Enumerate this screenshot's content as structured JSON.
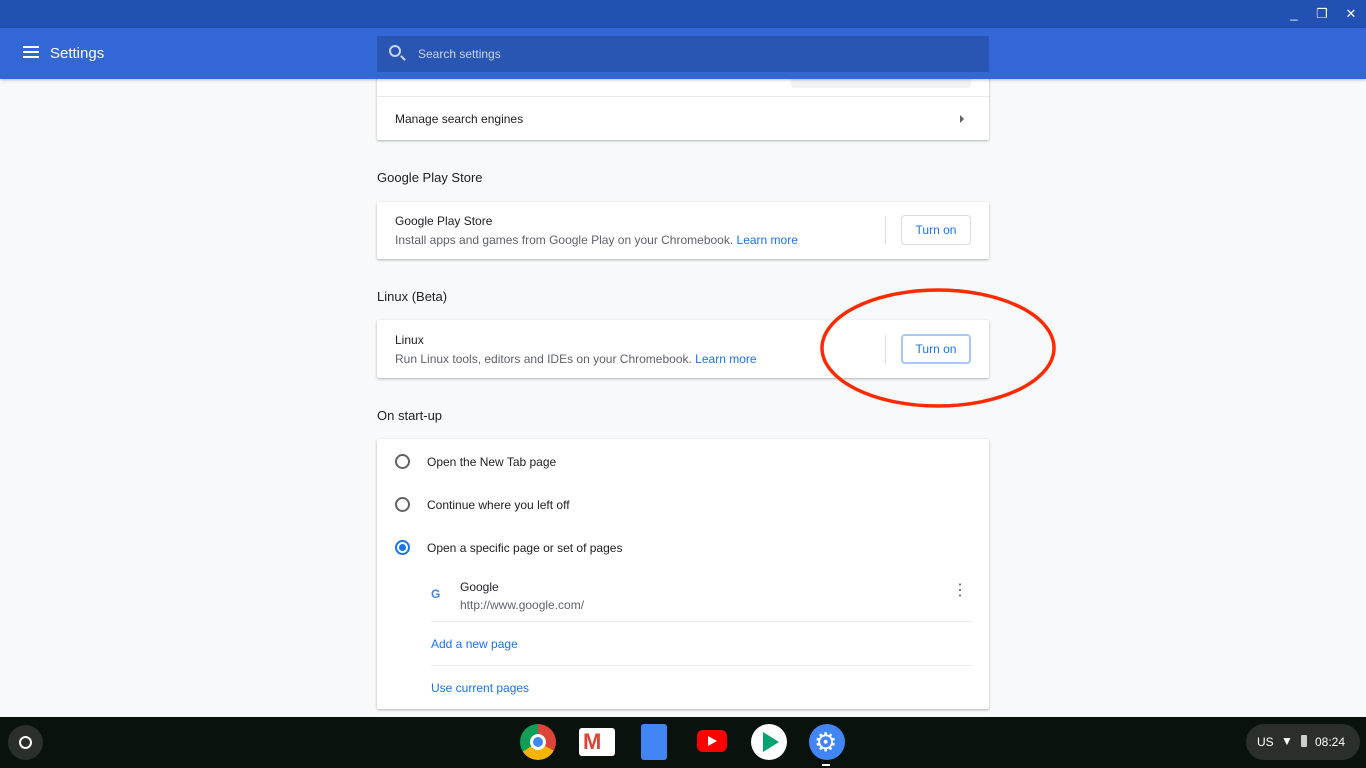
{
  "window": {
    "controls": [
      "minimize",
      "restore",
      "close"
    ]
  },
  "header": {
    "title": "Settings",
    "search_placeholder": "Search settings"
  },
  "search_engine": {
    "manage_label": "Manage search engines"
  },
  "play_store": {
    "section": "Google Play Store",
    "title": "Google Play Store",
    "desc": "Install apps and games from Google Play on your Chromebook.",
    "learn_more": "Learn more",
    "button": "Turn on"
  },
  "linux": {
    "section": "Linux (Beta)",
    "title": "Linux",
    "desc": "Run Linux tools, editors and IDEs on your Chromebook.",
    "learn_more": "Learn more",
    "button": "Turn on",
    "annotation_color": "#ff2a00"
  },
  "startup": {
    "section": "On start-up",
    "options": [
      {
        "label": "Open the New Tab page",
        "selected": false
      },
      {
        "label": "Continue where you left off",
        "selected": false
      },
      {
        "label": "Open a specific page or set of pages",
        "selected": true
      }
    ],
    "page": {
      "name": "Google",
      "url": "http://www.google.com/"
    },
    "add_page": "Add a new page",
    "use_current": "Use current pages"
  },
  "shelf": {
    "apps": [
      "chrome",
      "gmail",
      "docs",
      "youtube",
      "play-store",
      "settings"
    ]
  },
  "tray": {
    "ime": "US",
    "time": "08:24"
  },
  "colors": {
    "header": "#3367d6",
    "titlebar": "#2350b3",
    "accent": "#1a73e8"
  }
}
